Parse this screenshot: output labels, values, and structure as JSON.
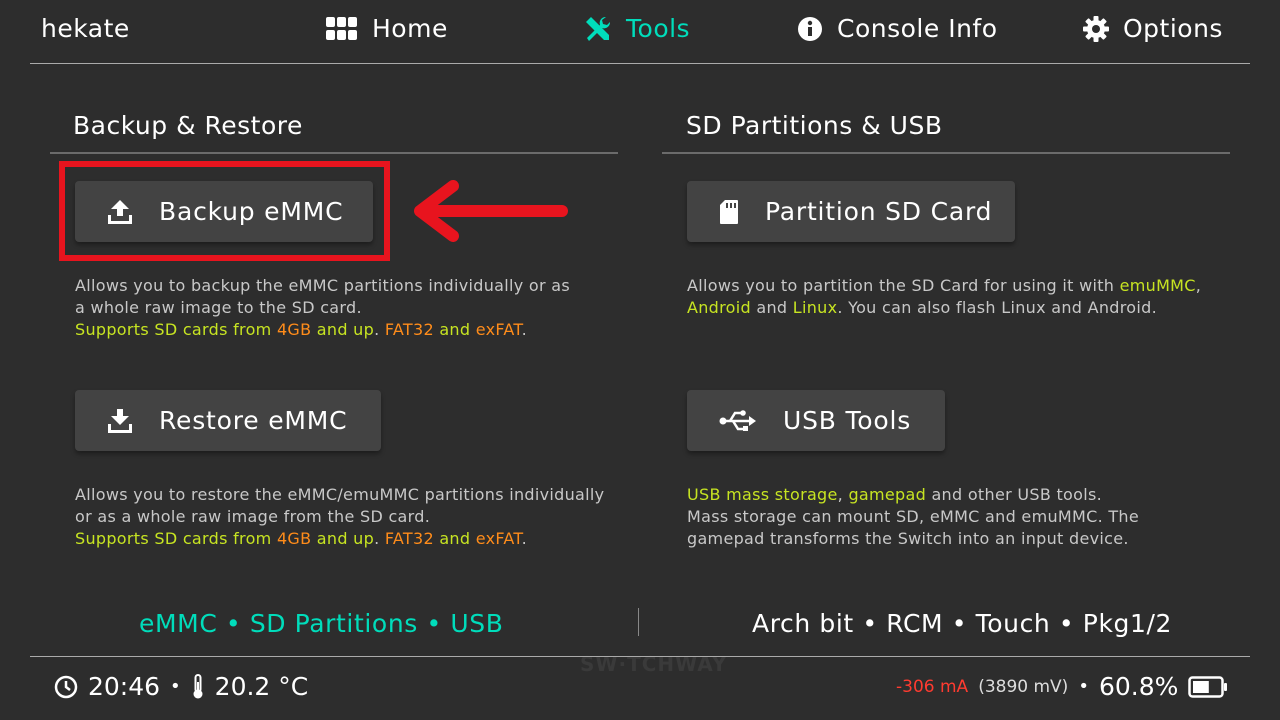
{
  "header": {
    "brand": "hekate",
    "tabs": [
      {
        "label": "Home",
        "icon": "grid-icon",
        "active": false
      },
      {
        "label": "Tools",
        "icon": "tools-icon",
        "active": true
      },
      {
        "label": "Console Info",
        "icon": "info-icon",
        "active": false
      },
      {
        "label": "Options",
        "icon": "gear-icon",
        "active": false
      }
    ]
  },
  "sections": {
    "backup": {
      "title": "Backup & Restore",
      "backup_button": "Backup eMMC",
      "backup_desc_1": "Allows you to backup the eMMC partitions individually or as",
      "backup_desc_2": "a whole raw image to the SD card.",
      "restore_button": "Restore eMMC",
      "restore_desc_1": "Allows you to restore the eMMC/emuMMC partitions individually",
      "restore_desc_2": "or as a whole raw image from the SD card.",
      "supports": {
        "a": "Supports SD cards from ",
        "b": "4GB",
        "c": " and up",
        "d": ". ",
        "e": "FAT32",
        "f": " and ",
        "g": "exFAT",
        "h": "."
      }
    },
    "sd_usb": {
      "title": "SD Partitions & USB",
      "partition_button": "Partition SD Card",
      "partition_desc": {
        "a": "Allows you to partition the SD Card for using it with ",
        "b": "emuMMC",
        "c": ",",
        "d": "Android",
        "e": " and ",
        "f": "Linux",
        "g": ". You can also flash Linux and Android."
      },
      "usb_button": "USB Tools",
      "usb_desc": {
        "a": "USB mass storage",
        "b": ", ",
        "c": "gamepad",
        "d": " and other USB tools.",
        "line2": "Mass storage can mount SD, eMMC and emuMMC. The",
        "line3": "gamepad transforms the Switch into an input device."
      }
    }
  },
  "subnav": {
    "left": "eMMC • SD Partitions • USB",
    "right": "Arch bit • RCM • Touch • Pkg1/2"
  },
  "statusbar": {
    "time": "20:46",
    "separator": "•",
    "temperature": "20.2 °C",
    "current": "-306 mA",
    "voltage": "(3890 mV)",
    "battery": "60.8%",
    "battery_level": 0.608
  },
  "watermark": "SW·TCHWAY",
  "colors": {
    "accent": "#00ddbb",
    "highlight_yellow": "#c7e422",
    "highlight_orange": "#ff8c1a",
    "annotation_red": "#e8141e"
  }
}
